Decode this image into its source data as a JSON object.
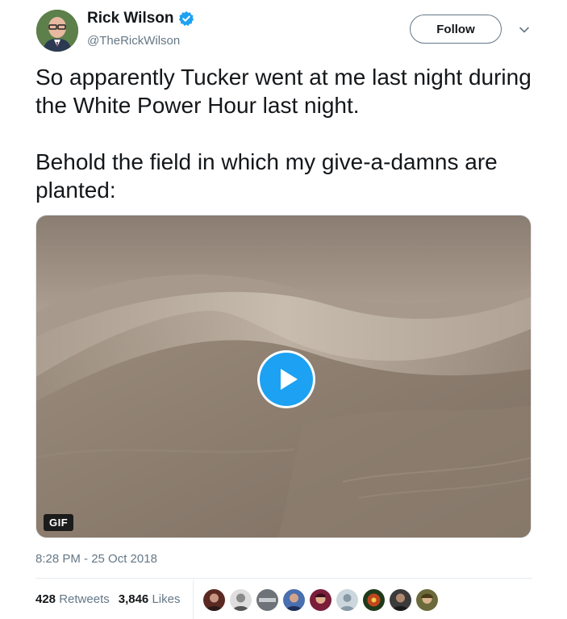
{
  "author": {
    "display_name": "Rick Wilson",
    "handle": "@TheRickWilson",
    "verified": true,
    "verified_color": "#1da1f2"
  },
  "follow_label": "Follow",
  "tweet": {
    "paragraphs": [
      "So apparently Tucker went at me last night during the White Power Hour last night.",
      "Behold the field in which my give-a-damns are planted:"
    ]
  },
  "media": {
    "badge": "GIF",
    "play_color": "#1da1f2",
    "icon": "play-icon"
  },
  "timestamp": "8:28 PM - 25 Oct 2018",
  "stats": {
    "retweets_count": "428",
    "retweets_label": "Retweets",
    "likes_count": "3,846",
    "likes_label": "Likes"
  },
  "likers": [
    {
      "color": "#5a2a22"
    },
    {
      "color": "#9a9a9a"
    },
    {
      "color": "#6d7378"
    },
    {
      "color": "#4a6fb0"
    },
    {
      "color": "#7a1e3a"
    },
    {
      "color": "#b8c2cc"
    },
    {
      "color": "#c0471d"
    },
    {
      "color": "#3b3b3b"
    },
    {
      "color": "#6b6a3a"
    }
  ]
}
